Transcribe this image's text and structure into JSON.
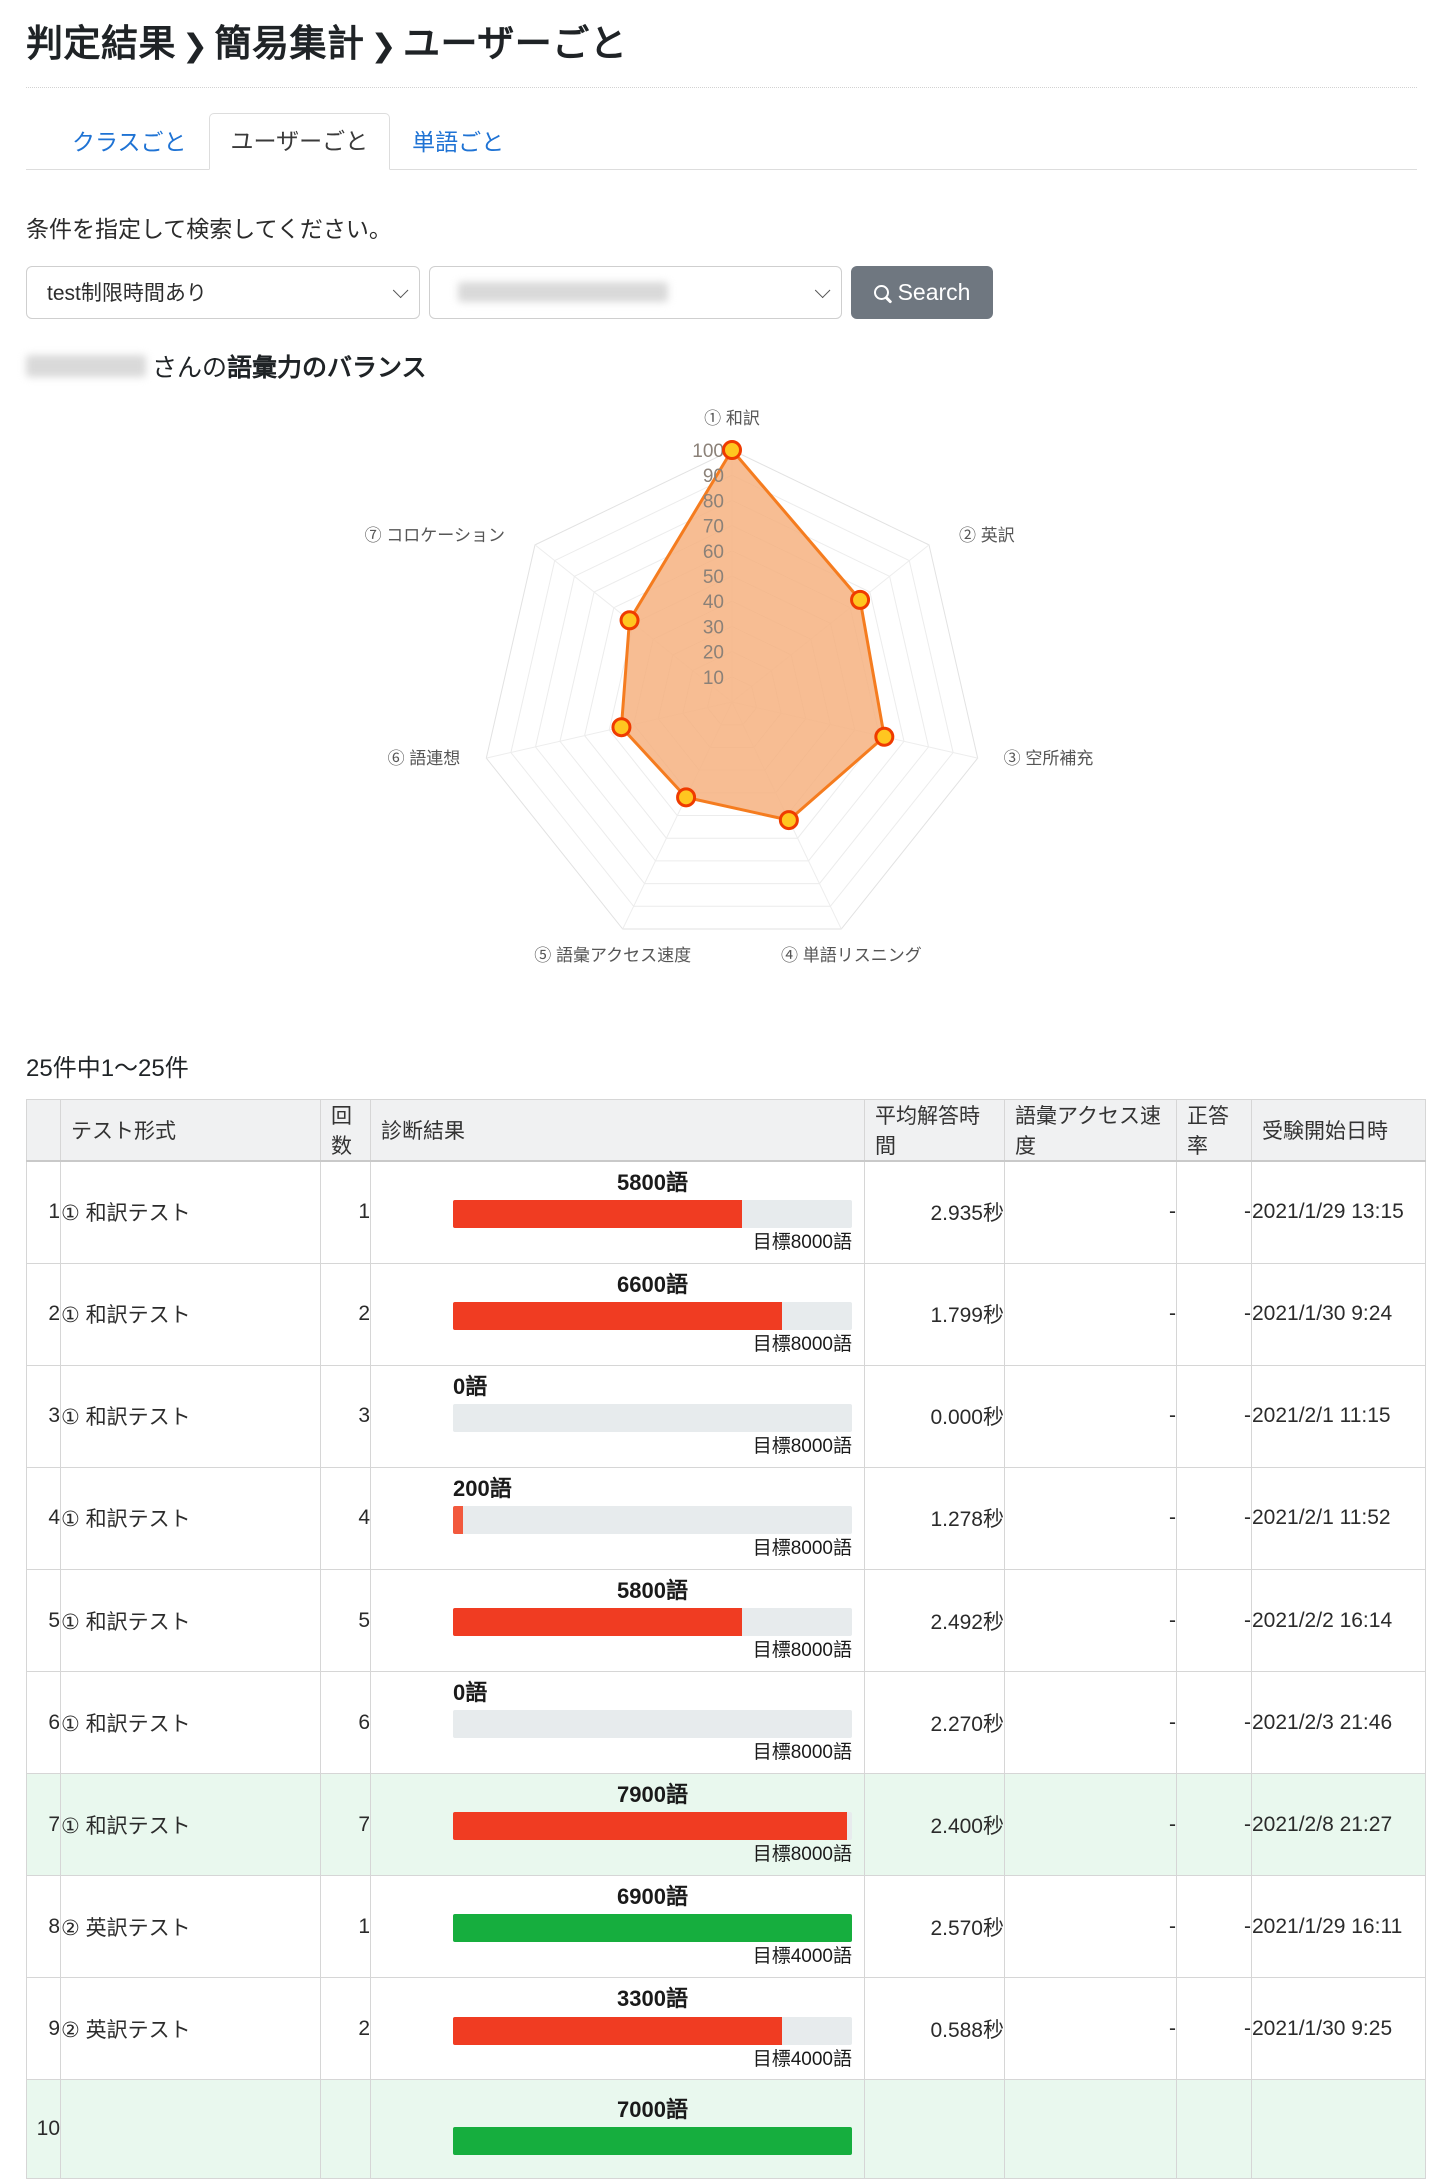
{
  "header": {
    "breadcrumb": [
      "判定結果",
      "簡易集計",
      "ユーザーごと"
    ],
    "separator": "❯"
  },
  "tabs": [
    {
      "label": "クラスごと",
      "active": false
    },
    {
      "label": "ユーザーごと",
      "active": true
    },
    {
      "label": "単語ごと",
      "active": false
    }
  ],
  "search": {
    "note": "条件を指定して検索してください。",
    "test_select_value": "test制限時間あり",
    "user_select_value": "",
    "button_label": "Search",
    "button_icon": "search-icon"
  },
  "chart_caption": {
    "name": "",
    "suffix": "さんの ",
    "title": "語彙力のバランス"
  },
  "chart_data": {
    "type": "radar",
    "title": "語彙力のバランス",
    "categories": [
      "① 和訳",
      "② 英訳",
      "③ 空所補充",
      "④ 単語リスニング",
      "⑤ 語彙アクセス速度",
      "⑥ 語連想",
      "⑦ コロケーション"
    ],
    "values": [
      100,
      65,
      62,
      52,
      42,
      45,
      52
    ],
    "ylim": [
      0,
      100
    ],
    "tick_labels": [
      10,
      20,
      30,
      40,
      50,
      60,
      70,
      80,
      90,
      100
    ],
    "tick_step": 10,
    "grid": true,
    "legend": "none",
    "fill_color": "#f6b180",
    "line_color": "#f57c1f",
    "point_fill": "#ffc620",
    "point_stroke": "#ef3b00"
  },
  "table": {
    "count_text": "25件中1〜25件",
    "columns": [
      "",
      "テスト形式",
      "回数",
      "診断結果",
      "平均解答時間",
      "語彙アクセス速度",
      "正答率",
      "受験開始日時"
    ],
    "rows": [
      {
        "idx": "1",
        "type": "① 和訳テスト",
        "times": "1",
        "value": "5800語",
        "pct": 72.5,
        "color": "#f03c22",
        "goal": "目標8000語",
        "avg": "2.935秒",
        "speed": "-",
        "rate": "-",
        "date": "2021/1/29 13:15",
        "highlight": false,
        "label_align": "center"
      },
      {
        "idx": "2",
        "type": "① 和訳テスト",
        "times": "2",
        "value": "6600語",
        "pct": 82.5,
        "color": "#f03c22",
        "goal": "目標8000語",
        "avg": "1.799秒",
        "speed": "-",
        "rate": "-",
        "date": "2021/1/30 9:24",
        "highlight": false,
        "label_align": "center"
      },
      {
        "idx": "3",
        "type": "① 和訳テスト",
        "times": "3",
        "value": "0語",
        "pct": 0,
        "color": "#f03c22",
        "goal": "目標8000語",
        "avg": "0.000秒",
        "speed": "-",
        "rate": "-",
        "date": "2021/2/1 11:15",
        "highlight": false,
        "label_align": "left"
      },
      {
        "idx": "4",
        "type": "① 和訳テスト",
        "times": "4",
        "value": "200語",
        "pct": 2.5,
        "color": "#f2593d",
        "goal": "目標8000語",
        "avg": "1.278秒",
        "speed": "-",
        "rate": "-",
        "date": "2021/2/1 11:52",
        "highlight": false,
        "label_align": "left"
      },
      {
        "idx": "5",
        "type": "① 和訳テスト",
        "times": "5",
        "value": "5800語",
        "pct": 72.5,
        "color": "#f03c22",
        "goal": "目標8000語",
        "avg": "2.492秒",
        "speed": "-",
        "rate": "-",
        "date": "2021/2/2 16:14",
        "highlight": false,
        "label_align": "center"
      },
      {
        "idx": "6",
        "type": "① 和訳テスト",
        "times": "6",
        "value": "0語",
        "pct": 0,
        "color": "#f03c22",
        "goal": "目標8000語",
        "avg": "2.270秒",
        "speed": "-",
        "rate": "-",
        "date": "2021/2/3 21:46",
        "highlight": false,
        "label_align": "left"
      },
      {
        "idx": "7",
        "type": "① 和訳テスト",
        "times": "7",
        "value": "7900語",
        "pct": 98.75,
        "color": "#f03c22",
        "goal": "目標8000語",
        "avg": "2.400秒",
        "speed": "-",
        "rate": "-",
        "date": "2021/2/8 21:27",
        "highlight": true,
        "label_align": "center"
      },
      {
        "idx": "8",
        "type": "② 英訳テスト",
        "times": "1",
        "value": "6900語",
        "pct": 100,
        "color": "#16ae3e",
        "goal": "目標4000語",
        "avg": "2.570秒",
        "speed": "-",
        "rate": "-",
        "date": "2021/1/29 16:11",
        "highlight": false,
        "label_align": "center"
      },
      {
        "idx": "9",
        "type": "② 英訳テスト",
        "times": "2",
        "value": "3300語",
        "pct": 82.5,
        "color": "#f03c22",
        "goal": "目標4000語",
        "avg": "0.588秒",
        "speed": "-",
        "rate": "-",
        "date": "2021/1/30 9:25",
        "highlight": false,
        "label_align": "center"
      },
      {
        "idx": "10",
        "type": "",
        "times": "",
        "value": "7000語",
        "pct": 100,
        "color": "#16ae3e",
        "goal": "",
        "avg": "",
        "speed": "",
        "rate": "",
        "date": "",
        "highlight": true,
        "label_align": "center"
      }
    ]
  }
}
